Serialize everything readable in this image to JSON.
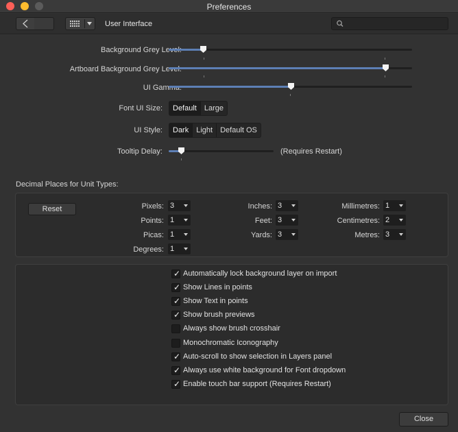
{
  "window": {
    "title": "Preferences"
  },
  "toolbar": {
    "section_title": "User Interface"
  },
  "sliders": [
    {
      "label": "Background Grey Level:",
      "value": 0.14
    },
    {
      "label": "Artboard Background Grey Level:",
      "value": 0.89
    },
    {
      "label": "UI Gamma:",
      "value": 0.5
    },
    {
      "label": "Tooltip Delay:",
      "value": 0.12
    }
  ],
  "font_ui_size": {
    "label": "Font UI Size:",
    "options": [
      "Default",
      "Large"
    ],
    "selected": "Default"
  },
  "ui_style": {
    "label": "UI Style:",
    "options": [
      "Dark",
      "Light",
      "Default OS"
    ],
    "selected": "Dark"
  },
  "tooltip_note": "(Requires Restart)",
  "decimal": {
    "heading": "Decimal Places for Unit Types:",
    "reset_label": "Reset",
    "units": [
      {
        "label": "Pixels:",
        "value": "3"
      },
      {
        "label": "Points:",
        "value": "1"
      },
      {
        "label": "Picas:",
        "value": "1"
      },
      {
        "label": "Degrees:",
        "value": "1"
      },
      {
        "label": "Inches:",
        "value": "3"
      },
      {
        "label": "Feet:",
        "value": "3"
      },
      {
        "label": "Yards:",
        "value": "3"
      },
      {
        "label": "Millimetres:",
        "value": "1"
      },
      {
        "label": "Centimetres:",
        "value": "2"
      },
      {
        "label": "Metres:",
        "value": "3"
      }
    ]
  },
  "options": [
    {
      "label": "Automatically lock background layer on import",
      "checked": true
    },
    {
      "label": "Show Lines in points",
      "checked": true
    },
    {
      "label": "Show Text in points",
      "checked": true
    },
    {
      "label": "Show brush previews",
      "checked": true
    },
    {
      "label": "Always show brush crosshair",
      "checked": false
    },
    {
      "label": "Monochromatic Iconography",
      "checked": false
    },
    {
      "label": "Auto-scroll to show selection in Layers panel",
      "checked": true
    },
    {
      "label": "Always use white background for Font dropdown",
      "checked": true
    },
    {
      "label": "Enable touch bar support (Requires Restart)",
      "checked": true
    }
  ],
  "footer": {
    "close_label": "Close"
  },
  "icons": {
    "back": "chevron-left-icon",
    "grid": "grid-icon",
    "dropdown": "triangle-down-icon",
    "search": "search-icon",
    "check": "checkmark-icon"
  },
  "colors": {
    "accent": "#5d7fb5",
    "close": "#fe5f57",
    "minimize": "#febc2e"
  }
}
